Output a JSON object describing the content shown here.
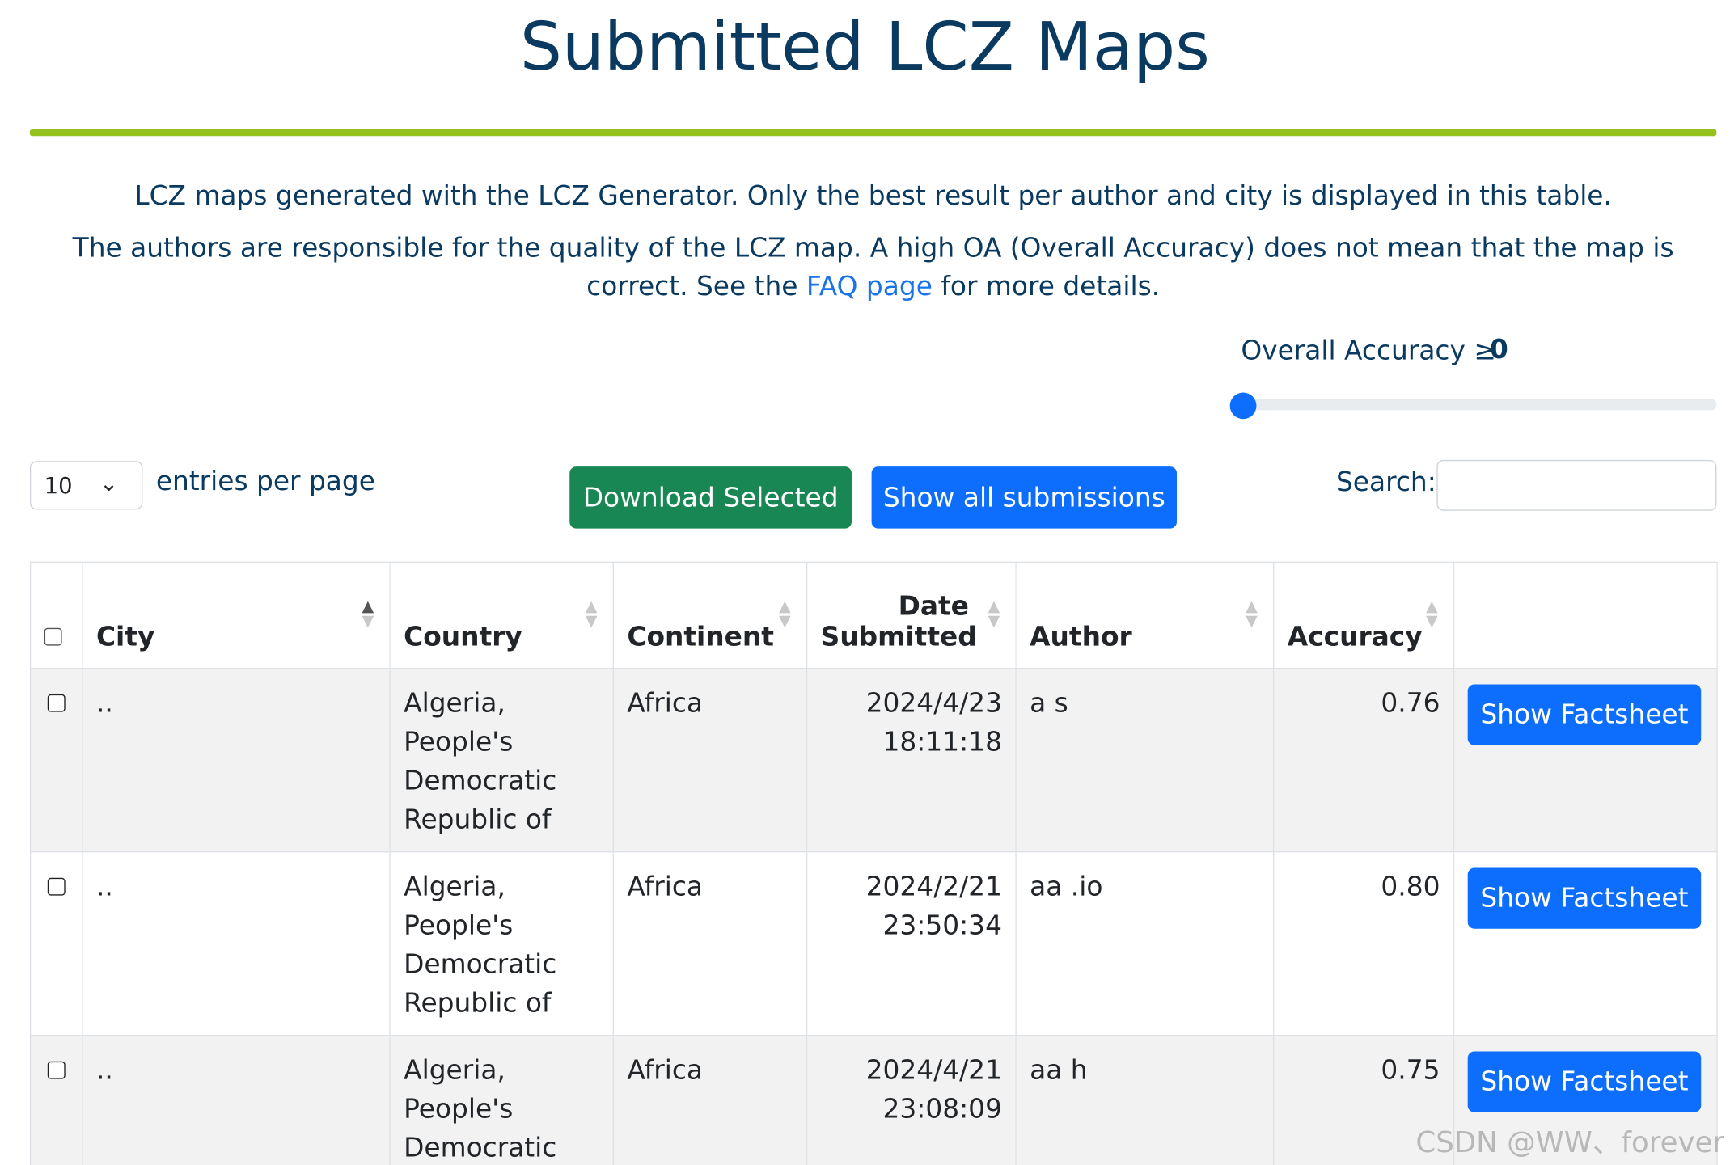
{
  "page": {
    "title": "Submitted LCZ Maps",
    "intro_line1": "LCZ maps generated with the LCZ Generator. Only the best result per author and city is displayed in this table.",
    "intro_line2_before": "The authors are responsible for the quality of the LCZ map. A high OA (Overall Accuracy) does not mean that the map is correct. See the",
    "faq_link": "FAQ page",
    "intro_line2_after": "for more details.",
    "watermark": "CSDN @WW、forever"
  },
  "filter": {
    "accuracy_label": "Overall Accuracy ≥",
    "accuracy_value": "0",
    "slider_level": 0
  },
  "controls": {
    "entries_value": "10",
    "entries_label": "entries per page",
    "download_label": "Download Selected",
    "show_all_label": "Show all submissions",
    "search_label": "Search:",
    "search_value": ""
  },
  "table": {
    "headers": {
      "city": "City",
      "country": "Country",
      "continent": "Continent",
      "date_line1": "Date",
      "date_line2": "Submitted",
      "author": "Author",
      "accuracy": "Accuracy"
    },
    "sorted_by": "City",
    "sort_direction": "ascending",
    "action_label": "Show Factsheet",
    "rows": [
      {
        "city": "..",
        "country": "Algeria, People's Democratic Republic of",
        "continent": "Africa",
        "date": "2024/4/23",
        "time": "18:11:18",
        "author": "a s",
        "accuracy": "0.76"
      },
      {
        "city": "..",
        "country": "Algeria, People's Democratic Republic of",
        "continent": "Africa",
        "date": "2024/2/21",
        "time": "23:50:34",
        "author": "aa .io",
        "accuracy": "0.80"
      },
      {
        "city": "..",
        "country": "Algeria, People's Democratic Republic of",
        "continent": "Africa",
        "date": "2024/4/21",
        "time": "23:08:09",
        "author": "aa h",
        "accuracy": "0.75"
      }
    ]
  },
  "colors": {
    "heading": "#0b3a61",
    "rule": "#95c11f",
    "link": "#1a73e8",
    "primary": "#0d6efd",
    "success": "#198754"
  }
}
